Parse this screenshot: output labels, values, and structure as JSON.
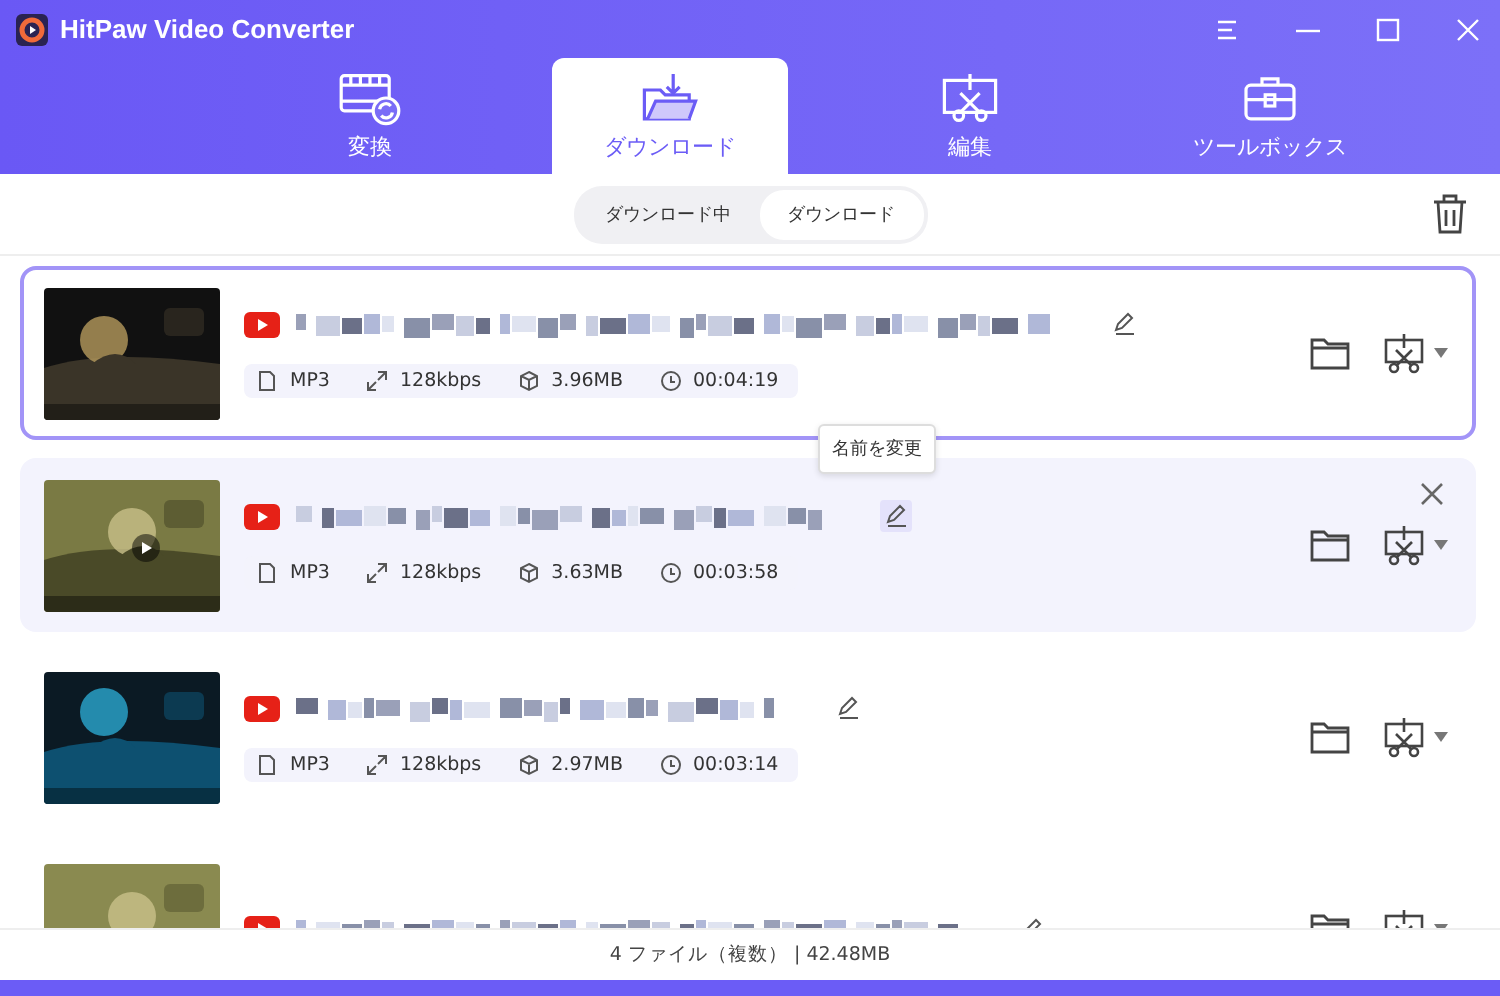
{
  "window": {
    "title": "HitPaw Video Converter"
  },
  "tabs": [
    {
      "label": "変換",
      "kind": "film",
      "selected": false
    },
    {
      "label": "ダウンロード",
      "kind": "download",
      "selected": true
    },
    {
      "label": "編集",
      "kind": "cut",
      "selected": false
    },
    {
      "label": "ツールボックス",
      "kind": "toolbox",
      "selected": false
    }
  ],
  "subtabs": [
    {
      "label": "ダウンロード中",
      "selected": false
    },
    {
      "label": "ダウンロード",
      "selected": true
    }
  ],
  "items": [
    {
      "selected": true,
      "hovered": false,
      "meta": {
        "format": "MP3",
        "bitrate": "128kbps",
        "size": "3.96MB",
        "duration": "00:04:19"
      }
    },
    {
      "selected": false,
      "hovered": true,
      "tooltip": "名前を変更",
      "meta": {
        "format": "MP3",
        "bitrate": "128kbps",
        "size": "3.63MB",
        "duration": "00:03:58"
      }
    },
    {
      "selected": false,
      "hovered": false,
      "meta": {
        "format": "MP3",
        "bitrate": "128kbps",
        "size": "2.97MB",
        "duration": "00:03:14"
      }
    },
    {
      "selected": false,
      "hovered": false
    }
  ],
  "status_bar": "4 ファイル（複数） | 42.48MB"
}
